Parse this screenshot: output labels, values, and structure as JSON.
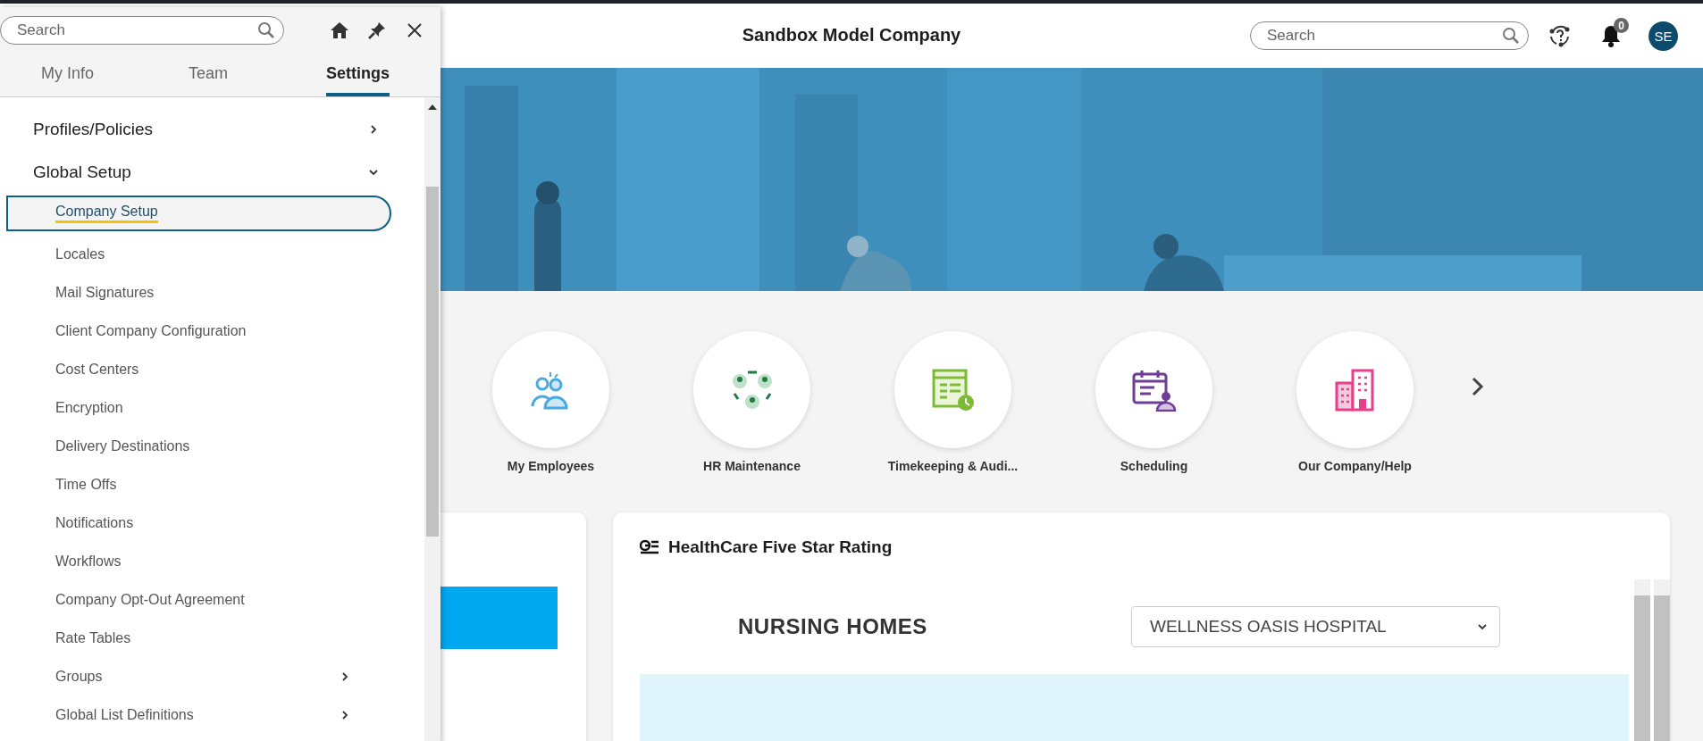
{
  "header": {
    "title": "Sandbox Model Company",
    "search": {
      "placeholder": "Search"
    },
    "notifications": {
      "count": "0"
    },
    "avatar": {
      "initials": "SE"
    }
  },
  "tiles": [
    {
      "kind": "employees",
      "label": "My Employees"
    },
    {
      "kind": "hr",
      "label": "HR Maintenance"
    },
    {
      "kind": "timekeeping",
      "label": "Timekeeping & Audi..."
    },
    {
      "kind": "scheduling",
      "label": "Scheduling"
    },
    {
      "kind": "company",
      "label": "Our Company/Help"
    }
  ],
  "rating_card": {
    "title": "HealthCare Five Star Rating",
    "heading": "NURSING HOMES",
    "facility_select": {
      "value": "WELLNESS OASIS HOSPITAL"
    }
  },
  "side_panel": {
    "search": {
      "placeholder": "Search"
    },
    "tabs": [
      {
        "label": "My Info",
        "selected": false
      },
      {
        "label": "Team",
        "selected": false
      },
      {
        "label": "Settings",
        "selected": true
      }
    ],
    "items": [
      {
        "label": "Profiles/Policies",
        "expanded": false
      },
      {
        "label": "Global Setup",
        "expanded": true,
        "children": [
          {
            "label": "Company Setup",
            "selected": true
          },
          {
            "label": "Locales",
            "selected": false
          },
          {
            "label": "Mail Signatures",
            "selected": false
          },
          {
            "label": "Client Company Configuration",
            "selected": false
          },
          {
            "label": "Cost Centers",
            "selected": false
          },
          {
            "label": "Encryption",
            "selected": false
          },
          {
            "label": "Delivery Destinations",
            "selected": false
          },
          {
            "label": "Time Offs",
            "selected": false
          },
          {
            "label": "Notifications",
            "selected": false
          },
          {
            "label": "Workflows",
            "selected": false
          },
          {
            "label": "Company Opt-Out Agreement",
            "selected": false
          },
          {
            "label": "Rate Tables",
            "selected": false
          },
          {
            "label": "Groups",
            "selected": false,
            "expanded": false
          },
          {
            "label": "Global List Definitions",
            "selected": false,
            "expanded": false
          }
        ]
      }
    ]
  }
}
